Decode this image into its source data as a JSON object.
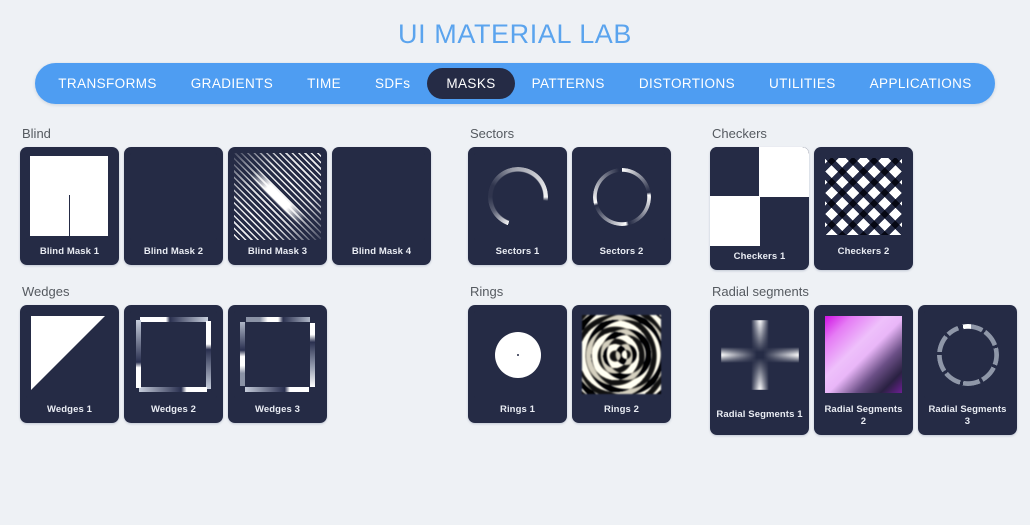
{
  "header": {
    "title": "UI MATERIAL LAB"
  },
  "nav": {
    "items": [
      {
        "label": "TRANSFORMS",
        "active": false
      },
      {
        "label": "GRADIENTS",
        "active": false
      },
      {
        "label": "TIME",
        "active": false
      },
      {
        "label": "SDFs",
        "active": false
      },
      {
        "label": "MASKS",
        "active": true
      },
      {
        "label": "PATTERNS",
        "active": false
      },
      {
        "label": "DISTORTIONS",
        "active": false
      },
      {
        "label": "UTILITIES",
        "active": false
      },
      {
        "label": "APPLICATIONS",
        "active": false
      }
    ]
  },
  "sections": {
    "blind": {
      "title": "Blind",
      "cards": [
        {
          "label": "Blind Mask 1"
        },
        {
          "label": "Blind Mask 2"
        },
        {
          "label": "Blind Mask 3"
        },
        {
          "label": "Blind Mask 4"
        }
      ]
    },
    "sectors": {
      "title": "Sectors",
      "cards": [
        {
          "label": "Sectors 1"
        },
        {
          "label": "Sectors 2"
        }
      ]
    },
    "checkers": {
      "title": "Checkers",
      "cards": [
        {
          "label": "Checkers 1"
        },
        {
          "label": "Checkers 2"
        }
      ]
    },
    "wedges": {
      "title": "Wedges",
      "cards": [
        {
          "label": "Wedges 1"
        },
        {
          "label": "Wedges 2"
        },
        {
          "label": "Wedges 3"
        }
      ]
    },
    "rings": {
      "title": "Rings",
      "cards": [
        {
          "label": "Rings 1"
        },
        {
          "label": "Rings 2"
        }
      ]
    },
    "radial_segments": {
      "title": "Radial segments",
      "cards": [
        {
          "label": "Radial Segments 1"
        },
        {
          "label": "Radial Segments 2"
        },
        {
          "label": "Radial Segments 3"
        }
      ]
    }
  },
  "colors": {
    "background": "#eef1f5",
    "accent": "#4e9df2",
    "title": "#5ba4ee",
    "card": "#252b45",
    "card_label": "#e9ecf3",
    "section_title": "#555a60",
    "magenta": "#cf12e2"
  }
}
